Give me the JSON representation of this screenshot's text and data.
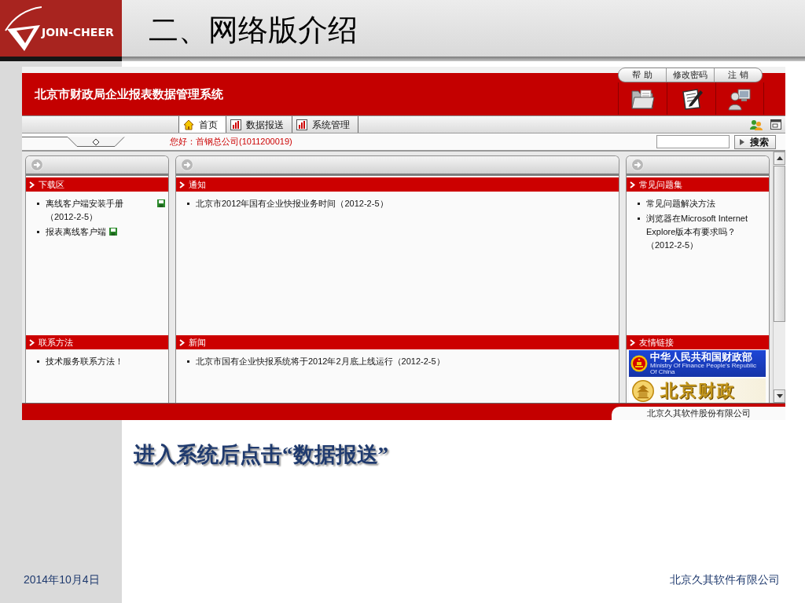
{
  "header": {
    "logo": "JOIN-CHEER",
    "title": "二、网络版介绍"
  },
  "app": {
    "title": "北京市财政局企业报表数据管理系统",
    "top_links": [
      "帮 助",
      "修改密码",
      "注 销"
    ],
    "nav_tabs": [
      {
        "label": "首页",
        "kind": "home",
        "selected": true
      },
      {
        "label": "数据报送",
        "kind": "module",
        "selected": false
      },
      {
        "label": "系统管理",
        "kind": "module",
        "selected": false
      }
    ],
    "greeting": "您好：首钢总公司(1011200019)",
    "search_button": "搜索",
    "columns": [
      {
        "sections": [
          {
            "kind": "list",
            "title": "下载区",
            "items": [
              {
                "text": "离线客户端安装手册（2012-2-5）",
                "attachment": true
              },
              {
                "text": "报表离线客户端",
                "attachment": true
              }
            ]
          },
          {
            "kind": "list",
            "title": "联系方法",
            "items": [
              {
                "text": "技术服务联系方法！"
              }
            ]
          }
        ]
      },
      {
        "sections": [
          {
            "kind": "list",
            "title": "通知",
            "items": [
              {
                "text": "北京市2012年国有企业快报业务时间（2012-2-5）"
              }
            ]
          },
          {
            "kind": "list",
            "title": "新闻",
            "items": [
              {
                "text": "北京市国有企业快报系统将于2012年2月底上线运行（2012-2-5）"
              }
            ]
          }
        ]
      },
      {
        "sections": [
          {
            "kind": "list",
            "title": "常见问题集",
            "items": [
              {
                "text": "常见问题解决方法"
              },
              {
                "text": "浏览器在Microsoft Internet Explore版本有要求吗？（2012-2-5）"
              }
            ]
          },
          {
            "kind": "links",
            "title": "友情链接",
            "banners": [
              {
                "kind": "ministry",
                "title": "中华人民共和国财政部",
                "subtitle": "Ministry Of Finance People's Republic Of China"
              },
              {
                "kind": "bureau",
                "title": "北京财政"
              }
            ]
          }
        ]
      }
    ],
    "footer": "北京久其软件股份有限公司"
  },
  "caption": "进入系统后点击“数据报送”",
  "footer": {
    "date": "2014年10月4日",
    "company": "北京久其软件有限公司"
  }
}
